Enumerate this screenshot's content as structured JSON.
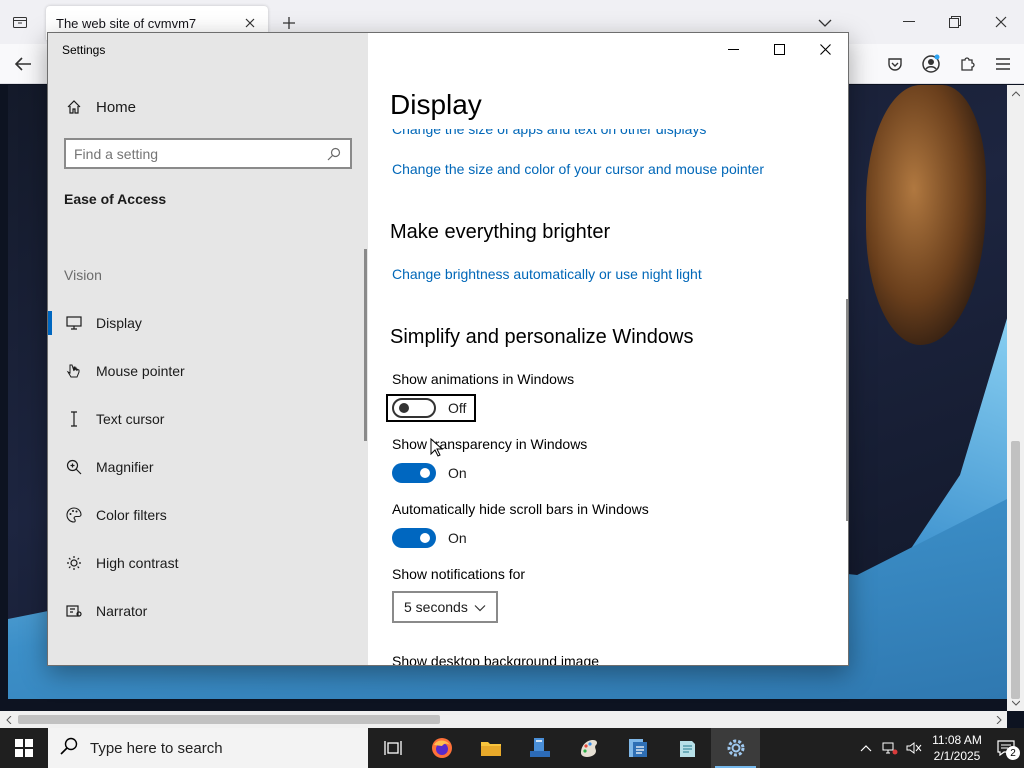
{
  "browser": {
    "tab_title": "The web site of cvmvm7",
    "colors": {
      "chrome": "#f0f0f4",
      "accent": "#0067c0"
    }
  },
  "settings": {
    "window_title": "Settings",
    "sidebar": {
      "home_label": "Home",
      "search_placeholder": "Find a setting",
      "section_title": "Ease of Access",
      "group_label": "Vision",
      "items": [
        {
          "label": "Display",
          "icon": "monitor-icon",
          "active": true
        },
        {
          "label": "Mouse pointer",
          "icon": "mouse-pointer-icon"
        },
        {
          "label": "Text cursor",
          "icon": "text-cursor-icon"
        },
        {
          "label": "Magnifier",
          "icon": "magnifier-icon"
        },
        {
          "label": "Color filters",
          "icon": "palette-icon"
        },
        {
          "label": "High contrast",
          "icon": "sun-icon"
        },
        {
          "label": "Narrator",
          "icon": "narrator-icon"
        }
      ]
    },
    "content": {
      "title": "Display",
      "link_apps_text": "Change the size of apps and text on other displays",
      "link_cursor": "Change the size and color of your cursor and mouse pointer",
      "heading_brighter": "Make everything brighter",
      "link_brightness": "Change brightness automatically or use night light",
      "heading_simplify": "Simplify and personalize Windows",
      "animations": {
        "label": "Show animations in Windows",
        "state": "Off"
      },
      "transparency": {
        "label": "Show transparency in Windows",
        "state": "On"
      },
      "scrollbars": {
        "label": "Automatically hide scroll bars in Windows",
        "state": "On"
      },
      "notifications": {
        "label": "Show notifications for",
        "value": "5 seconds"
      },
      "desktop_bg_label": "Show desktop background image"
    }
  },
  "taskbar": {
    "search_placeholder": "Type here to search",
    "time": "11:08 AM",
    "date": "2/1/2025",
    "notification_count": "2"
  }
}
